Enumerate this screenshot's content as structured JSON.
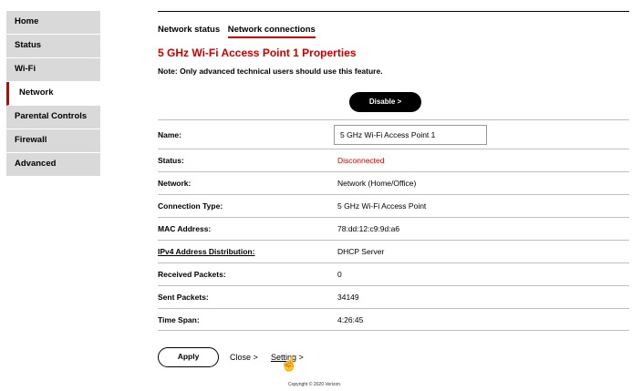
{
  "sidebar": {
    "items": [
      {
        "label": "Home"
      },
      {
        "label": "Status"
      },
      {
        "label": "Wi-Fi"
      },
      {
        "label": "Network"
      },
      {
        "label": "Parental Controls"
      },
      {
        "label": "Firewall"
      },
      {
        "label": "Advanced"
      }
    ],
    "active_index": 3
  },
  "tabs": [
    {
      "label": "Network status"
    },
    {
      "label": "Network connections"
    }
  ],
  "title": "5 GHz Wi-Fi Access Point 1 Properties",
  "note": "Note: Only advanced technical users should use this feature.",
  "disable_button": "Disable >",
  "rows": {
    "name": {
      "label": "Name:",
      "value": "5 GHz Wi-Fi Access Point 1"
    },
    "status": {
      "label": "Status:",
      "value": "Disconnected"
    },
    "network": {
      "label": "Network:",
      "value": "Network (Home/Office)"
    },
    "connection_type": {
      "label": "Connection Type:",
      "value": "5 GHz Wi-Fi Access Point"
    },
    "mac": {
      "label": "MAC Address:",
      "value": "78:dd:12:c9:9d:a6"
    },
    "ipv4": {
      "label": "IPv4 Address Distribution:",
      "value": "DHCP Server"
    },
    "received": {
      "label": "Received Packets:",
      "value": "0"
    },
    "sent": {
      "label": "Sent Packets:",
      "value": "34149"
    },
    "time_span": {
      "label": "Time Span:",
      "value": "4:26:45"
    }
  },
  "footer": {
    "apply": "Apply",
    "close": "Close >",
    "setting": "Setting",
    "setting_arrow": ">",
    "copyright": "Copyright © 2020 Verizon."
  },
  "colors": {
    "accent": "#cc0000",
    "sidebar_bg": "#d9d9d9"
  }
}
